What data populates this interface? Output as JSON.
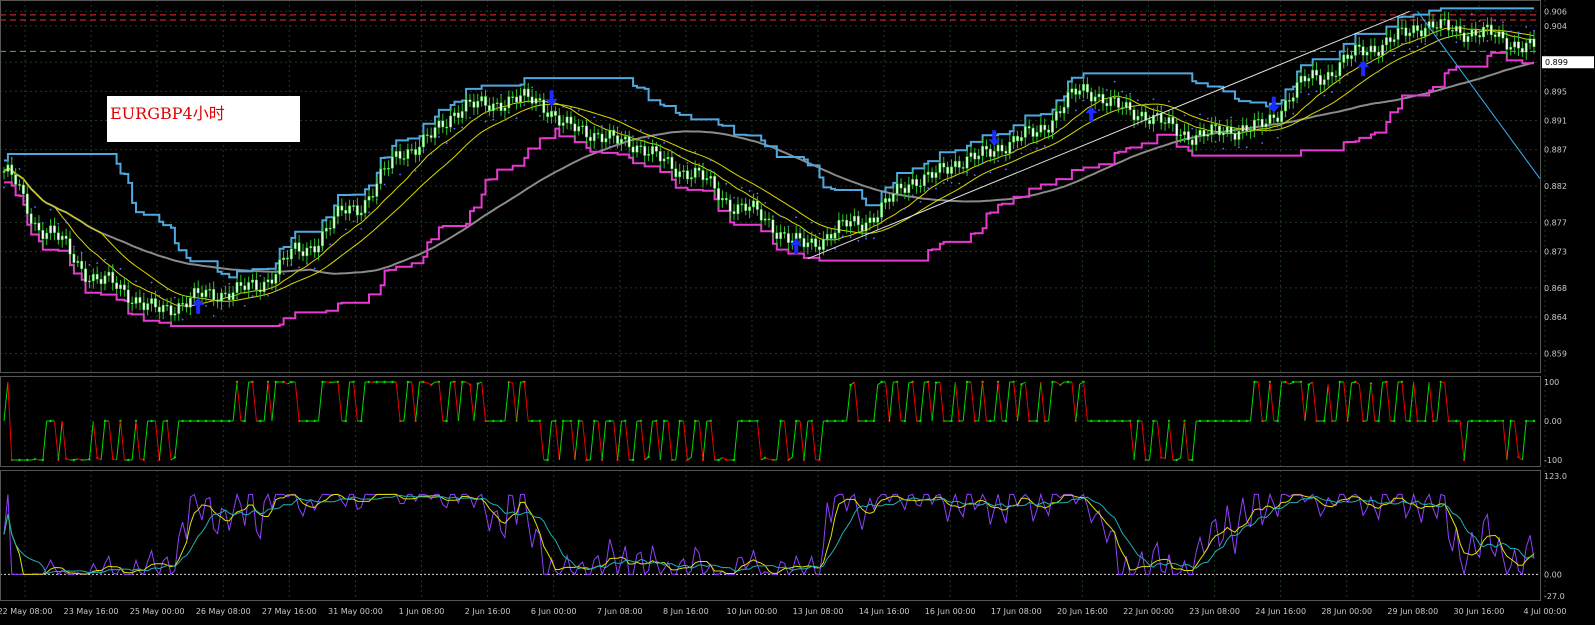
{
  "symbol_label": "EURGBP4小时",
  "colors": {
    "background": "#000000",
    "grid": "#1e3a1e",
    "bull_candle": "#ccffcc",
    "bear_candle": "#ffffff",
    "upper_band": "#4fa8e0",
    "lower_band": "#e83ad0",
    "ma_yellow": "#d8d800",
    "ma_gray": "#8a8a8a",
    "signal_up": "#1d2bff",
    "stoch_green": "#00dd00",
    "stoch_red": "#ee0000",
    "osc_purple": "#9040ff",
    "osc_yellow": "#e0e000",
    "osc_teal": "#20b0b0"
  },
  "chart_data": [
    {
      "type": "candlestick",
      "title": "EURGBP4小时",
      "price_ticks": [
        "0.906",
        "0.904",
        "0.899",
        "0.895",
        "0.891",
        "0.887",
        "0.882",
        "0.877",
        "0.873",
        "0.868",
        "0.864",
        "0.859"
      ],
      "y_range": [
        0.857,
        0.907
      ],
      "price_readout": "0.899",
      "time_labels": [
        "22 May 08:00",
        "23 May 16:00",
        "25 May 00:00",
        "26 May 08:00",
        "27 May 16:00",
        "31 May 00:00",
        "1 Jun 08:00",
        "2 Jun 16:00",
        "6 Jun 00:00",
        "7 Jun 08:00",
        "8 Jun 16:00",
        "10 Jun 00:00",
        "13 Jun 08:00",
        "14 Jun 16:00",
        "16 Jun 00:00",
        "17 Jun 08:00",
        "20 Jun 16:00",
        "22 Jun 00:00",
        "23 Jun 08:00",
        "24 Jun 16:00",
        "28 Jun 00:00",
        "29 Jun 08:00",
        "30 Jun 16:00",
        "4 Jul 00:00"
      ],
      "close_anchors": [
        [
          0,
          0.884
        ],
        [
          10,
          0.876
        ],
        [
          25,
          0.869
        ],
        [
          40,
          0.865
        ],
        [
          52,
          0.867
        ],
        [
          64,
          0.868
        ],
        [
          76,
          0.873
        ],
        [
          90,
          0.879
        ],
        [
          104,
          0.887
        ],
        [
          120,
          0.893
        ],
        [
          136,
          0.894
        ],
        [
          146,
          0.89
        ],
        [
          160,
          0.888
        ],
        [
          176,
          0.884
        ],
        [
          190,
          0.879
        ],
        [
          206,
          0.874
        ],
        [
          220,
          0.877
        ],
        [
          236,
          0.883
        ],
        [
          250,
          0.886
        ],
        [
          264,
          0.889
        ],
        [
          278,
          0.895
        ],
        [
          292,
          0.892
        ],
        [
          306,
          0.889
        ],
        [
          322,
          0.89
        ],
        [
          338,
          0.897
        ],
        [
          352,
          0.901
        ],
        [
          366,
          0.904
        ],
        [
          380,
          0.903
        ],
        [
          394,
          0.901
        ]
      ],
      "candle_count": 395,
      "signal_arrows": [
        {
          "direction": "up",
          "index": 50
        },
        {
          "direction": "down",
          "index": 141
        },
        {
          "direction": "up",
          "index": 204
        },
        {
          "direction": "down",
          "index": 255
        },
        {
          "direction": "up",
          "index": 280
        },
        {
          "direction": "down",
          "index": 327
        },
        {
          "direction": "up",
          "index": 350
        }
      ]
    },
    {
      "type": "line",
      "name": "stochastic",
      "y_ticks": [
        "100",
        "0.00",
        "-100"
      ],
      "y_range": [
        -100,
        100
      ]
    },
    {
      "type": "line",
      "name": "oscillator",
      "y_ticks": [
        "123.0",
        "0.00",
        "-27.0"
      ],
      "y_range": [
        -27,
        123
      ]
    }
  ]
}
